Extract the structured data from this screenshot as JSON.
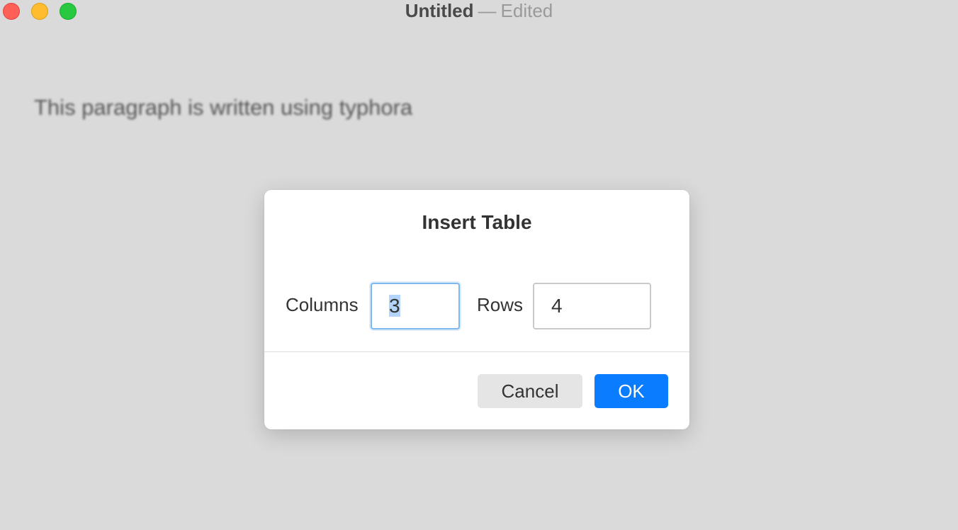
{
  "window": {
    "doc_name": "Untitled",
    "separator": "—",
    "state": "Edited",
    "controls": {
      "close_color": "#fe5f57",
      "minimize_color": "#febc2e",
      "zoom_color": "#28c840"
    }
  },
  "editor": {
    "paragraph": "This paragraph is written using typhora"
  },
  "dialog": {
    "title": "Insert Table",
    "columns_label": "Columns",
    "columns_value": "3",
    "rows_label": "Rows",
    "rows_value": "4",
    "cancel_label": "Cancel",
    "ok_label": "OK",
    "accent_color": "#0a7cff"
  }
}
